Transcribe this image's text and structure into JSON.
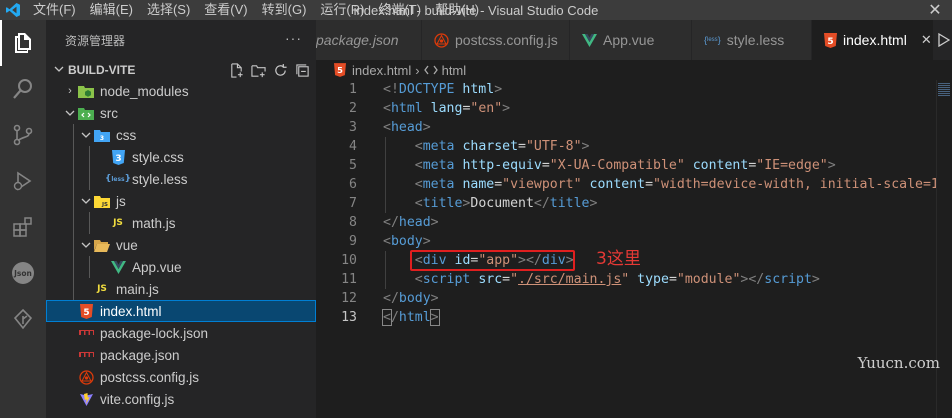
{
  "window": {
    "title": "index.html - build-vite - Visual Studio Code",
    "menu": [
      "文件(F)",
      "编辑(E)",
      "选择(S)",
      "查看(V)",
      "转到(G)",
      "运行(R)",
      "终端(T)",
      "帮助(H)"
    ],
    "close_glyph": "✕"
  },
  "activity_bar": {
    "items": [
      "files-icon",
      "search-icon",
      "source-control-icon",
      "run-debug-icon",
      "extensions-icon",
      "json-icon",
      "git-graph-icon"
    ],
    "json_label": "Json"
  },
  "explorer": {
    "header": "资源管理器",
    "more": "···",
    "project": "BUILD-VITE",
    "tree": [
      {
        "label": "node_modules",
        "type": "folder",
        "depth": 0,
        "expanded": false
      },
      {
        "label": "src",
        "type": "folder",
        "depth": 0,
        "expanded": true
      },
      {
        "label": "css",
        "type": "folder",
        "depth": 1,
        "expanded": true
      },
      {
        "label": "style.css",
        "type": "css",
        "depth": 2
      },
      {
        "label": "style.less",
        "type": "less",
        "depth": 2
      },
      {
        "label": "js",
        "type": "folder",
        "depth": 1,
        "expanded": true
      },
      {
        "label": "math.js",
        "type": "js",
        "depth": 2
      },
      {
        "label": "vue",
        "type": "folder",
        "depth": 1,
        "expanded": true
      },
      {
        "label": "App.vue",
        "type": "vue",
        "depth": 2
      },
      {
        "label": "main.js",
        "type": "js",
        "depth": 1
      },
      {
        "label": "index.html",
        "type": "html",
        "depth": 0,
        "selected": true
      },
      {
        "label": "package-lock.json",
        "type": "npm",
        "depth": 0
      },
      {
        "label": "package.json",
        "type": "npm",
        "depth": 0
      },
      {
        "label": "postcss.config.js",
        "type": "postcss",
        "depth": 0
      },
      {
        "label": "vite.config.js",
        "type": "vite",
        "depth": 0
      }
    ]
  },
  "tabs": [
    {
      "label": "package.json",
      "icon": "npm"
    },
    {
      "label": "postcss.config.js",
      "icon": "postcss"
    },
    {
      "label": "App.vue",
      "icon": "vue"
    },
    {
      "label": "style.less",
      "icon": "less"
    },
    {
      "label": "index.html",
      "icon": "html",
      "active": true
    }
  ],
  "breadcrumb": {
    "file": "index.html",
    "node": "html"
  },
  "editor": {
    "line_numbers": [
      "1",
      "2",
      "3",
      "4",
      "5",
      "6",
      "7",
      "8",
      "9",
      "10",
      "11",
      "12",
      "13"
    ],
    "current_line": "13",
    "annotation": "3这里"
  },
  "watermark": "Yuucn.com",
  "colors": {
    "tag": "#569cd6",
    "attribute": "#9cdcfe",
    "string": "#ce9178",
    "selection": "#094771",
    "annotation_red": "#e01f1f"
  }
}
